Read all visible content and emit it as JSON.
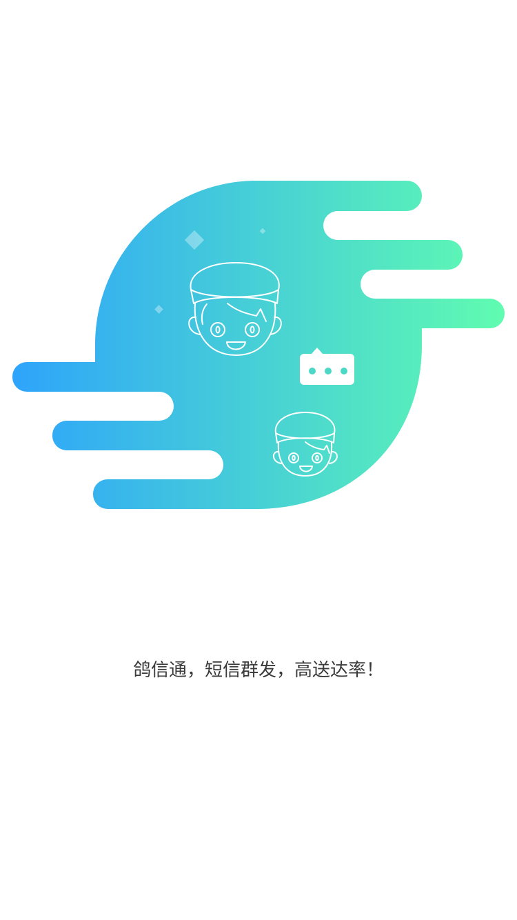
{
  "splash": {
    "tagline": "鸽信通，短信群发，高送达率！",
    "colors": {
      "background": "#ffffff",
      "gradient_start": "#2ea4fb",
      "gradient_end": "#60fcb0",
      "tagline_text": "#3a3a3a"
    },
    "icons": [
      "postman-large-icon",
      "postman-small-icon",
      "chat-bubble-icon",
      "sparkle-icon"
    ]
  }
}
